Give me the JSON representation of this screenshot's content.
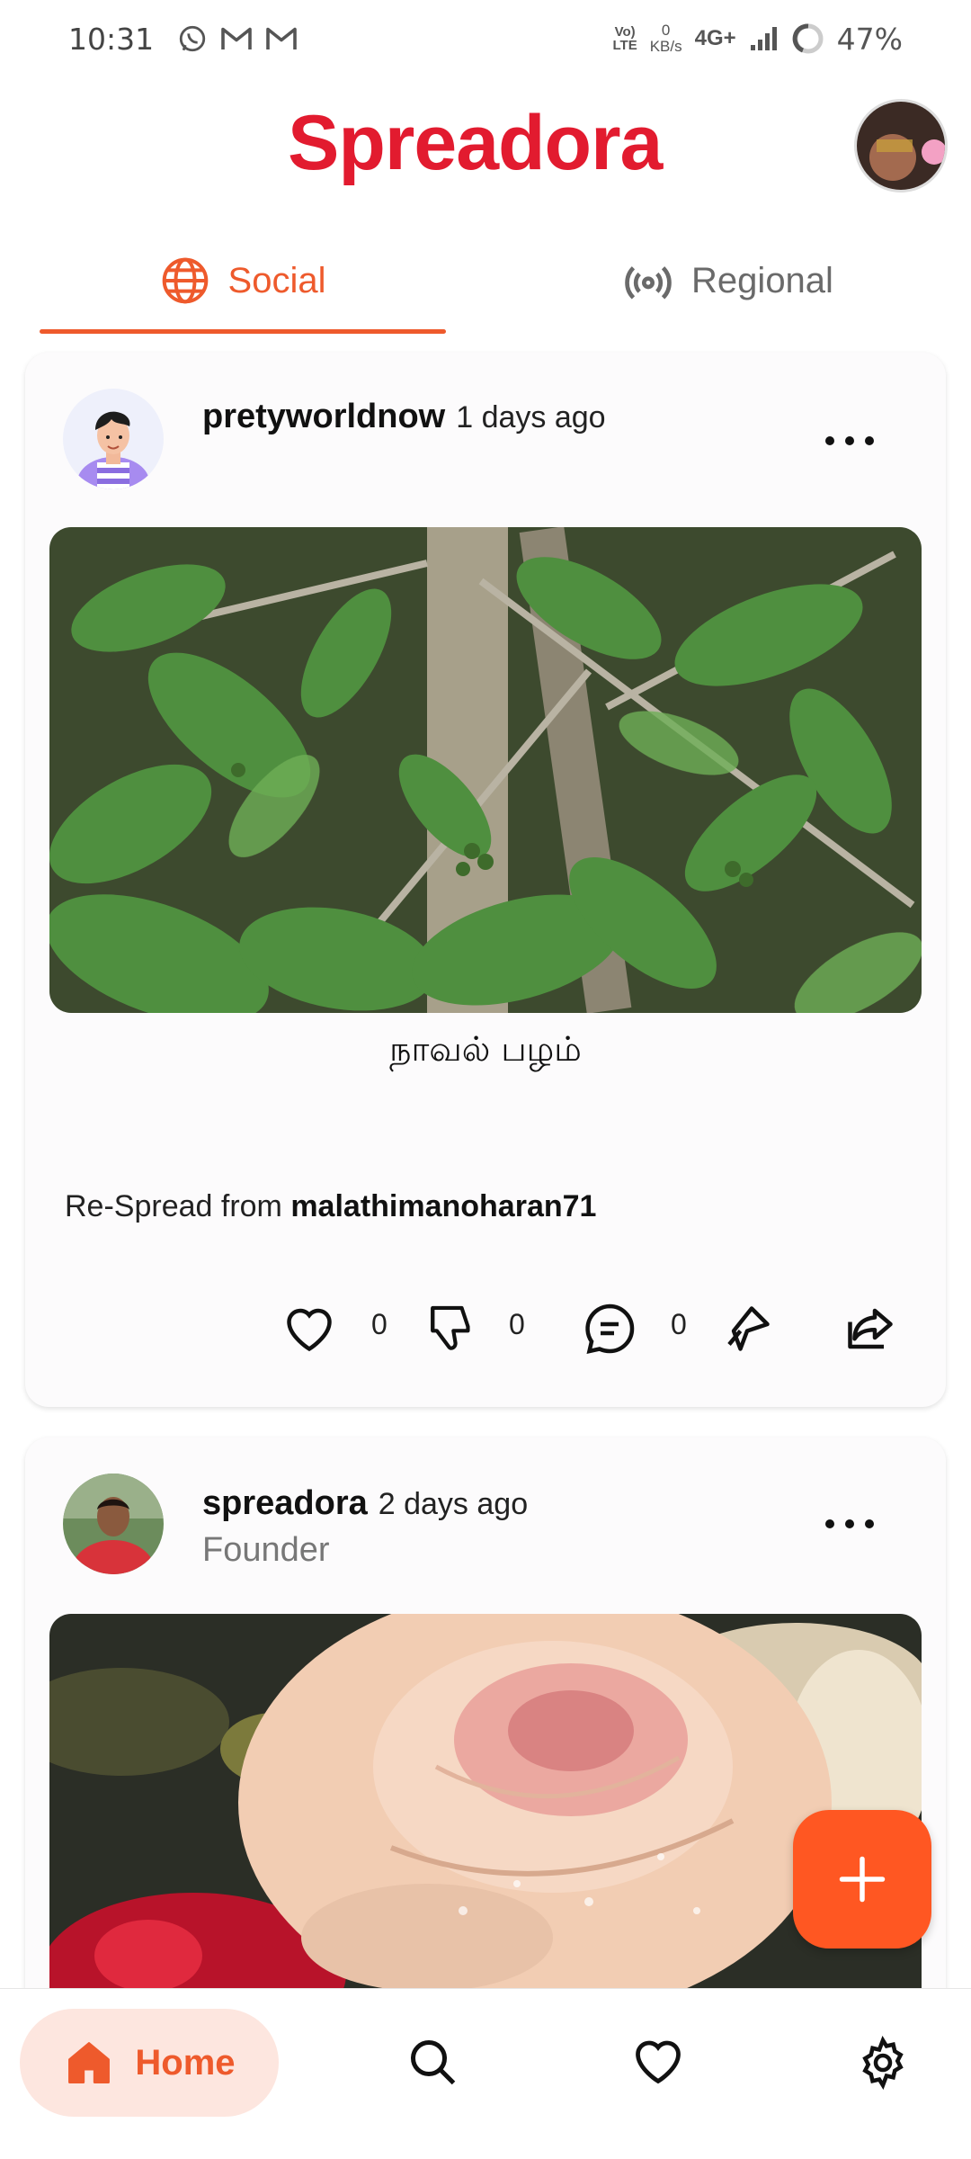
{
  "status_bar": {
    "time": "10:31",
    "volte_line1": "Vo)",
    "volte_line2": "LTE",
    "speed_value": "0",
    "speed_unit": "KB/s",
    "network": "4G+",
    "battery": "47%",
    "notification_icons": [
      "whatsapp-icon",
      "gmail-icon",
      "gmail-icon"
    ]
  },
  "header": {
    "logo_text": "Spreadora",
    "brand_color": "#e21b2f",
    "accent_color": "#ee5a2c"
  },
  "tabs": [
    {
      "label": "Social",
      "icon": "globe-icon",
      "active": true
    },
    {
      "label": "Regional",
      "icon": "broadcast-icon",
      "active": false
    }
  ],
  "posts": [
    {
      "username": "pretyworldnow",
      "time_ago": "1 days ago",
      "caption": "நாவல் பழம்",
      "respread_prefix": "Re-Spread from",
      "respread_user": "malathimanoharan71",
      "likes": "0",
      "dislikes": "0",
      "comments": "0"
    },
    {
      "username": "spreadora",
      "time_ago": "2 days ago",
      "role": "Founder"
    }
  ],
  "bottom_nav": {
    "home_label": "Home",
    "items": [
      "home-icon",
      "search-icon",
      "heart-icon",
      "settings-icon"
    ]
  }
}
